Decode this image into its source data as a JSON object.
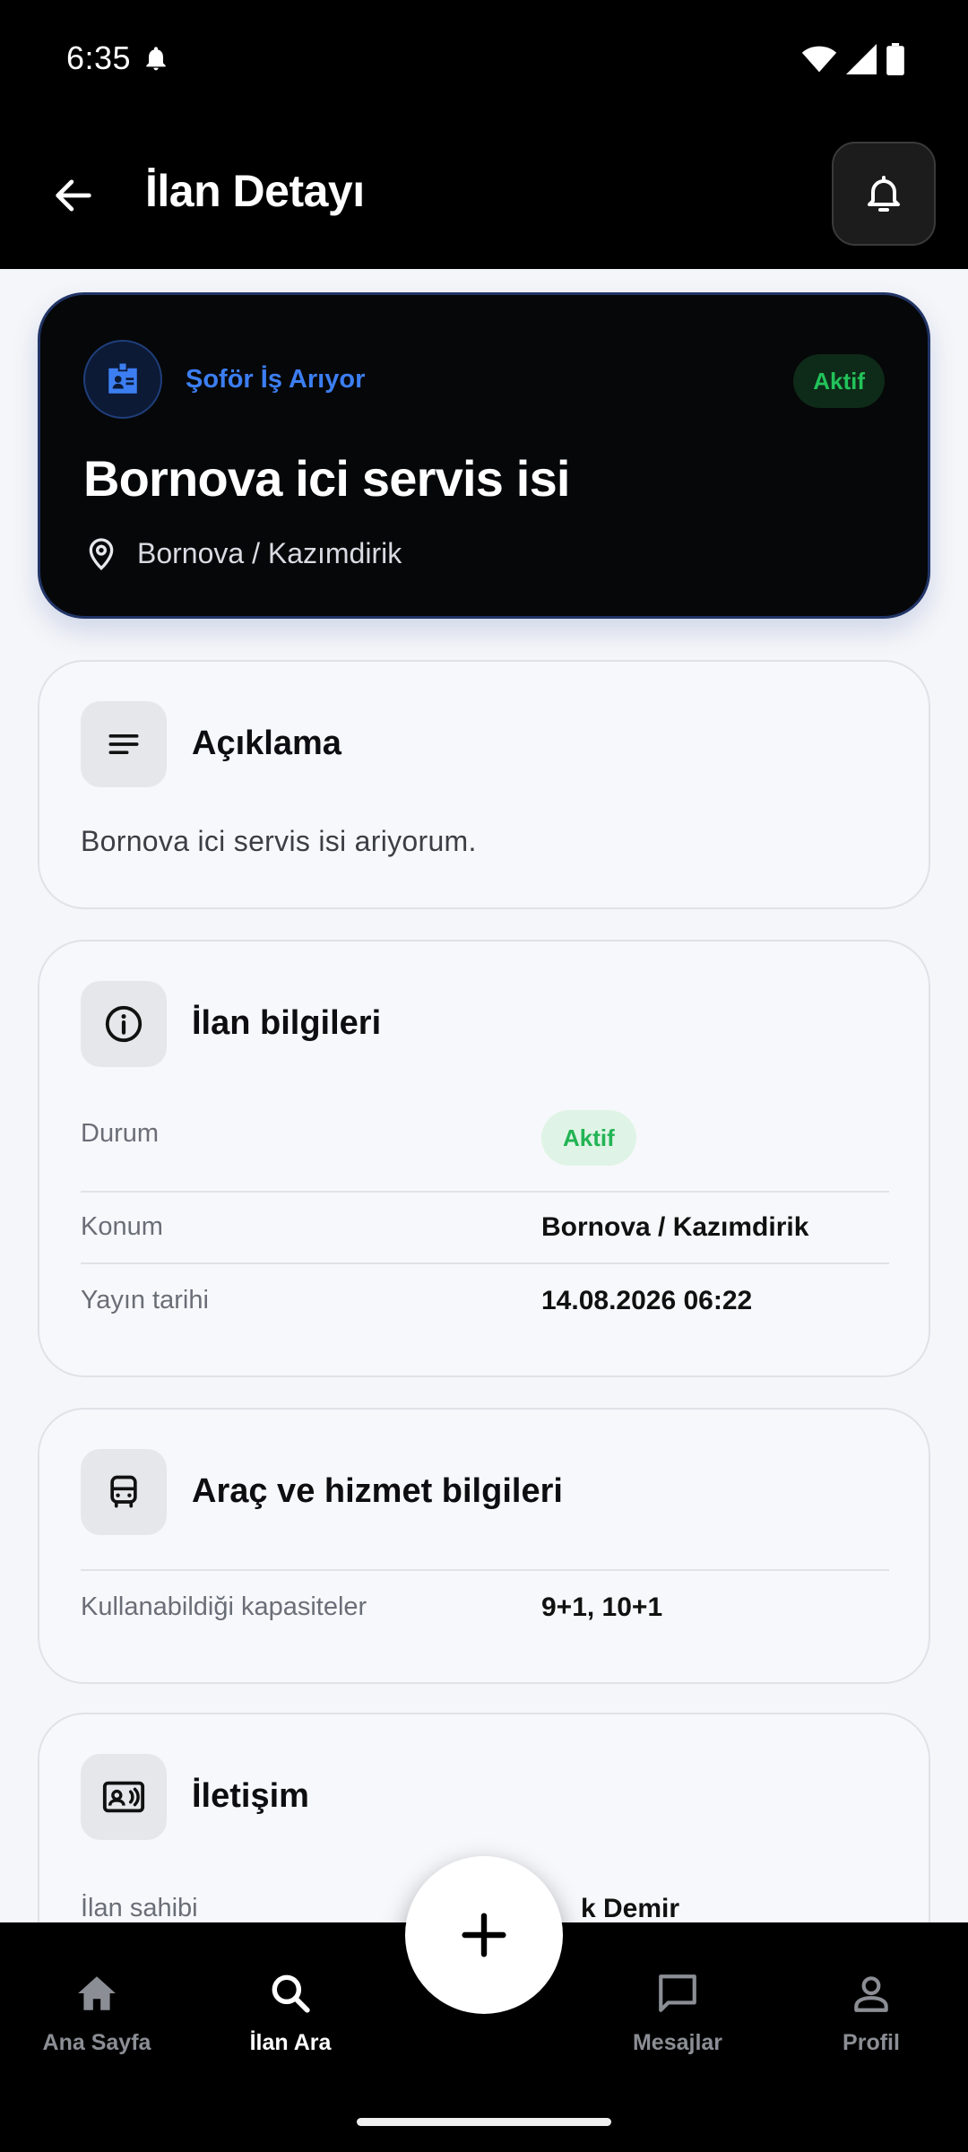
{
  "status_bar": {
    "time": "6:35"
  },
  "header": {
    "title": "İlan Detayı"
  },
  "hero": {
    "category": "Şoför İş Arıyor",
    "badge": "Aktif",
    "title": "Bornova ici servis isi",
    "location": "Bornova / Kazımdirik"
  },
  "description": {
    "title": "Açıklama",
    "text": "Bornova ici servis isi ariyorum."
  },
  "listing_info": {
    "title": "İlan bilgileri",
    "rows": [
      {
        "label": "Durum",
        "value": "Aktif"
      },
      {
        "label": "Konum",
        "value": "Bornova / Kazımdirik"
      },
      {
        "label": "Yayın tarihi",
        "value": "14.08.2026 06:22"
      }
    ]
  },
  "vehicle_info": {
    "title": "Araç ve hizmet bilgileri",
    "rows": [
      {
        "label": "Kullanabildiği kapasiteler",
        "value": "9+1, 10+1"
      }
    ]
  },
  "contact": {
    "title": "İletişim",
    "rows": [
      {
        "label": "İlan sahibi",
        "value": "k Demir"
      }
    ]
  },
  "bottom_nav": {
    "items": [
      {
        "label": "Ana Sayfa",
        "icon": "home-icon"
      },
      {
        "label": "İlan Ara",
        "icon": "search-icon",
        "active": true
      },
      {
        "label": "Mesajlar",
        "icon": "message-icon"
      },
      {
        "label": "Profil",
        "icon": "person-icon"
      }
    ],
    "fab_icon": "plus-icon"
  },
  "colors": {
    "accent_blue": "#3c7ef2",
    "active_green": "#22c25a",
    "dark_bg": "#000000",
    "page_bg": "#f5f6f9"
  }
}
